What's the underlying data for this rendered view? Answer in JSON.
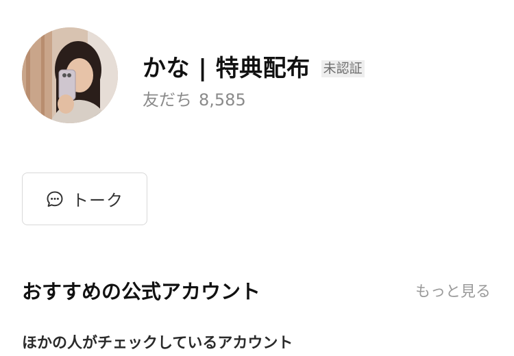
{
  "profile": {
    "name": "かな | 特典配布",
    "verify_badge": "未認証",
    "friends_label": "友だち",
    "friends_count": "8,585",
    "avatar_icon": "profile-photo"
  },
  "actions": {
    "talk_label": "トーク",
    "talk_icon": "chat-bubble-icon"
  },
  "recommended": {
    "title": "おすすめの公式アカウント",
    "see_more_label": "もっと見る",
    "subtitle": "ほかの人がチェックしているアカウント"
  },
  "colors": {
    "text_primary": "#111111",
    "text_secondary": "#8a8a8a",
    "badge_bg": "#eeeeee",
    "button_border": "#d8d8d8"
  }
}
